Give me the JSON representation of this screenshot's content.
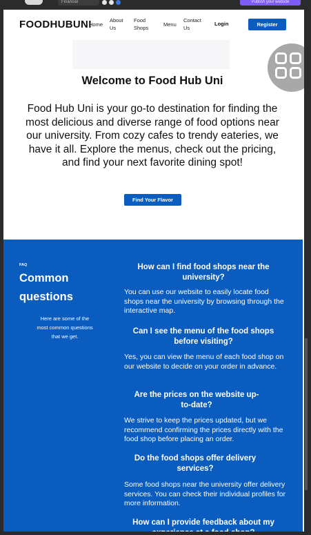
{
  "chrome": {
    "select_label": "Financial",
    "publish_label": "Publish your website"
  },
  "nav": {
    "logo": "FOODHUBUNI",
    "links": [
      "Home",
      "About Us",
      "Food Shops",
      "Menu",
      "Contact Us"
    ],
    "login": "Login",
    "register": "Register"
  },
  "hero": {
    "title": "Welcome to Food Hub Uni",
    "text": "Food Hub Uni is your go-to destination for finding the most delicious and diverse range of food options near our university. From cozy cafes to trendy eateries, we have it all. Explore the menus, check out the pricing, and find your next favorite dining spot!",
    "cta": "Find Your Flavor"
  },
  "faq": {
    "tag": "FAQ",
    "title": "Common questions",
    "subtitle": "Here are some of the most common questions that we get.",
    "items": [
      {
        "q": "How can I find food shops near the university?",
        "a": "You can use our website to easily locate food shops near the university by browsing through the interactive map."
      },
      {
        "q": "Can I see the menu of the food shops before visiting?",
        "a": "Yes, you can view the menu of each food shop on our website to decide on your order in advance."
      },
      {
        "q": "Are the prices on the website up-to-date?",
        "a": "We strive to keep the prices updated, but we recommend confirming the prices directly with the food shop before placing an order."
      },
      {
        "q": "Do the food shops offer delivery services?",
        "a": "Some food shops near the university offer delivery services. You can check their individual profiles for more information."
      },
      {
        "q": "How can I provide feedback about my experience at a food shop?",
        "a": ""
      }
    ]
  },
  "colors": {
    "accent": "#0a5cbf",
    "publish": "#7c5cf5"
  }
}
